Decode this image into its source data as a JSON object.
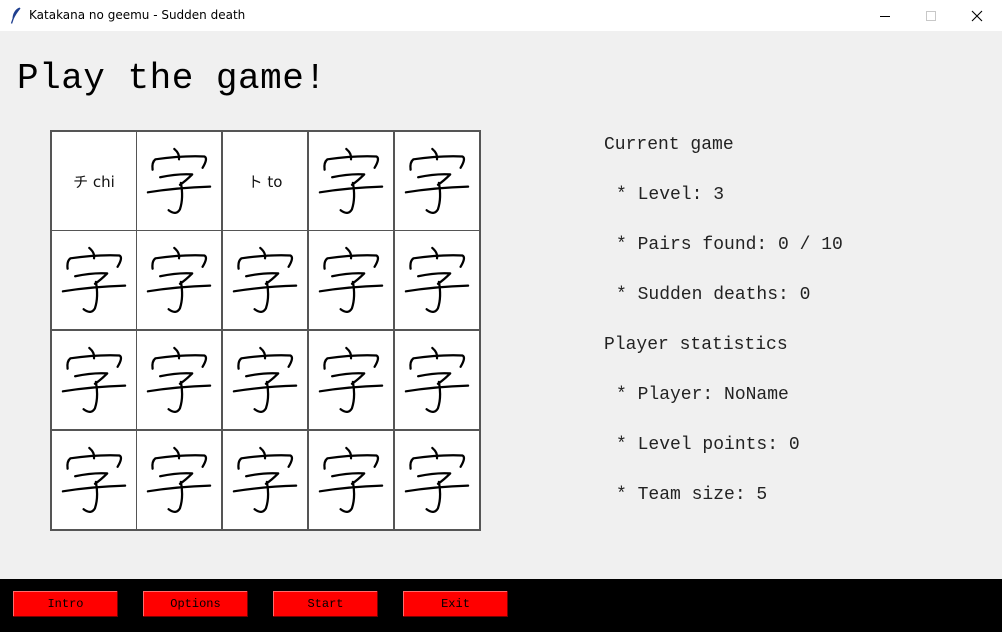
{
  "window": {
    "title": "Katakana no geemu - Sudden death",
    "icon": "feather-icon"
  },
  "heading": "Play the game!",
  "board": {
    "rows": 4,
    "cols": 5,
    "cards": [
      {
        "state": "revealed",
        "text": "チ chi"
      },
      {
        "state": "hidden",
        "icon": "kanji-ji-icon"
      },
      {
        "state": "revealed",
        "text": "ト to"
      },
      {
        "state": "hidden",
        "icon": "kanji-ji-icon"
      },
      {
        "state": "hidden",
        "icon": "kanji-ji-icon"
      },
      {
        "state": "hidden",
        "icon": "kanji-ji-icon"
      },
      {
        "state": "hidden",
        "icon": "kanji-ji-icon"
      },
      {
        "state": "hidden",
        "icon": "kanji-ji-icon"
      },
      {
        "state": "hidden",
        "icon": "kanji-ji-icon"
      },
      {
        "state": "hidden",
        "icon": "kanji-ji-icon"
      },
      {
        "state": "hidden",
        "icon": "kanji-ji-icon"
      },
      {
        "state": "hidden",
        "icon": "kanji-ji-icon"
      },
      {
        "state": "hidden",
        "icon": "kanji-ji-icon"
      },
      {
        "state": "hidden",
        "icon": "kanji-ji-icon"
      },
      {
        "state": "hidden",
        "icon": "kanji-ji-icon"
      },
      {
        "state": "hidden",
        "icon": "kanji-ji-icon"
      },
      {
        "state": "hidden",
        "icon": "kanji-ji-icon"
      },
      {
        "state": "hidden",
        "icon": "kanji-ji-icon"
      },
      {
        "state": "hidden",
        "icon": "kanji-ji-icon"
      },
      {
        "state": "hidden",
        "icon": "kanji-ji-icon"
      }
    ]
  },
  "stats": {
    "current_game_title": "Current game",
    "level": "* Level: 3",
    "pairs_found": "* Pairs found: 0 / 10",
    "sudden_deaths": "* Sudden deaths: 0",
    "player_stats_title": "Player statistics",
    "player": "* Player: NoName",
    "level_points": "* Level points: 0",
    "team_size": "* Team size: 5"
  },
  "buttons": {
    "intro": "Intro",
    "options": "Options",
    "start": "Start",
    "exit": "Exit"
  },
  "colors": {
    "button_bg": "#ff0000",
    "bottom_bar": "#000000",
    "background": "#f0f0f0",
    "card_bg": "#ffffff",
    "grid_line": "#555555"
  }
}
